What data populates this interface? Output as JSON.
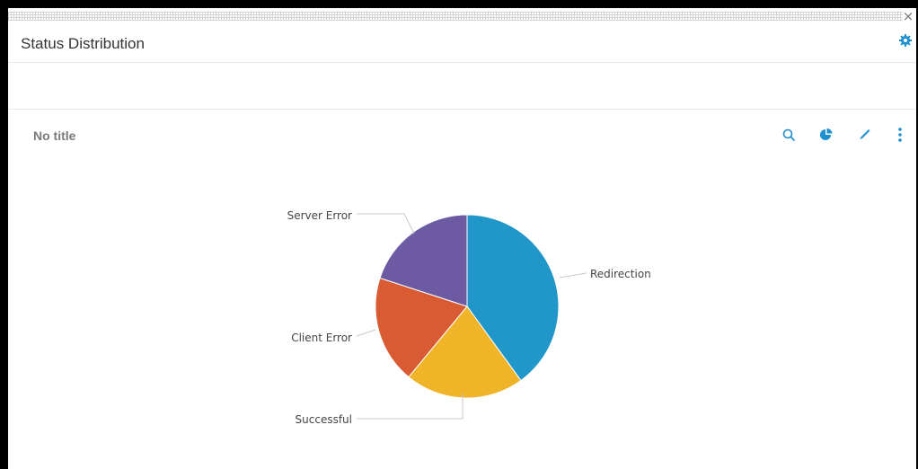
{
  "window": {
    "title": "Status Distribution",
    "close_glyph": "×"
  },
  "panel": {
    "title": "No title",
    "toolbar": [
      "search-icon",
      "pie-chart-icon",
      "edit-icon",
      "more-vertical-icon"
    ]
  },
  "colors": {
    "accent": "#1e8fcf",
    "redirection": "#2196c9",
    "successful": "#f0b429",
    "client_error": "#d95b34",
    "server_error": "#6c5ba3"
  },
  "chart_data": {
    "type": "pie",
    "title": "",
    "slices": [
      {
        "label": "Redirection",
        "value": 40,
        "color": "#2196c9"
      },
      {
        "label": "Successful",
        "value": 21,
        "color": "#f0b429"
      },
      {
        "label": "Client Error",
        "value": 19,
        "color": "#d95b34"
      },
      {
        "label": "Server Error",
        "value": 20,
        "color": "#6c5ba3"
      }
    ]
  }
}
